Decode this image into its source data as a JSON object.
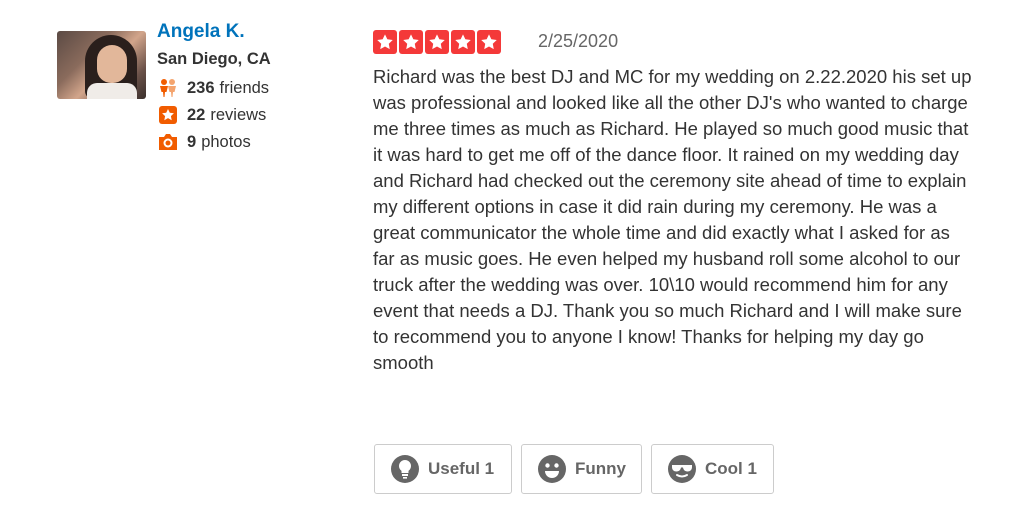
{
  "user": {
    "name": "Angela K.",
    "location": "San Diego, CA",
    "friends_count": "236",
    "friends_label": "friends",
    "reviews_count": "22",
    "reviews_label": "reviews",
    "photos_count": "9",
    "photos_label": "photos"
  },
  "review": {
    "rating": 5,
    "date": "2/25/2020",
    "text": "Richard was the best DJ and MC for my wedding on 2.22.2020 his set up was professional and looked like all the other DJ's who wanted to charge me three times as much as Richard. He played so much good music that it was hard to get me off of the dance floor. It rained on my wedding day and Richard had checked out the ceremony site ahead of time to explain my different options in case it did rain during my ceremony. He was a great communicator the whole time and did exactly what I asked for as far as music goes. He even helped my husband roll some alcohol to our truck after the wedding was over. 10\\10 would recommend him for any event that needs a DJ. Thank you so much Richard and I will make sure to recommend you to anyone I know! Thanks for helping my day go smooth"
  },
  "votes": {
    "useful_label": "Useful 1",
    "funny_label": "Funny",
    "cool_label": "Cool 1"
  },
  "colors": {
    "link": "#0073bb",
    "star": "#f43939",
    "icon_orange": "#f15c00",
    "icon_gray": "#666666"
  },
  "icons": [
    "avatar-photo",
    "friends-icon",
    "star-badge-icon",
    "camera-icon",
    "star-icon",
    "lightbulb-icon",
    "smiley-icon",
    "sunglasses-face-icon"
  ]
}
